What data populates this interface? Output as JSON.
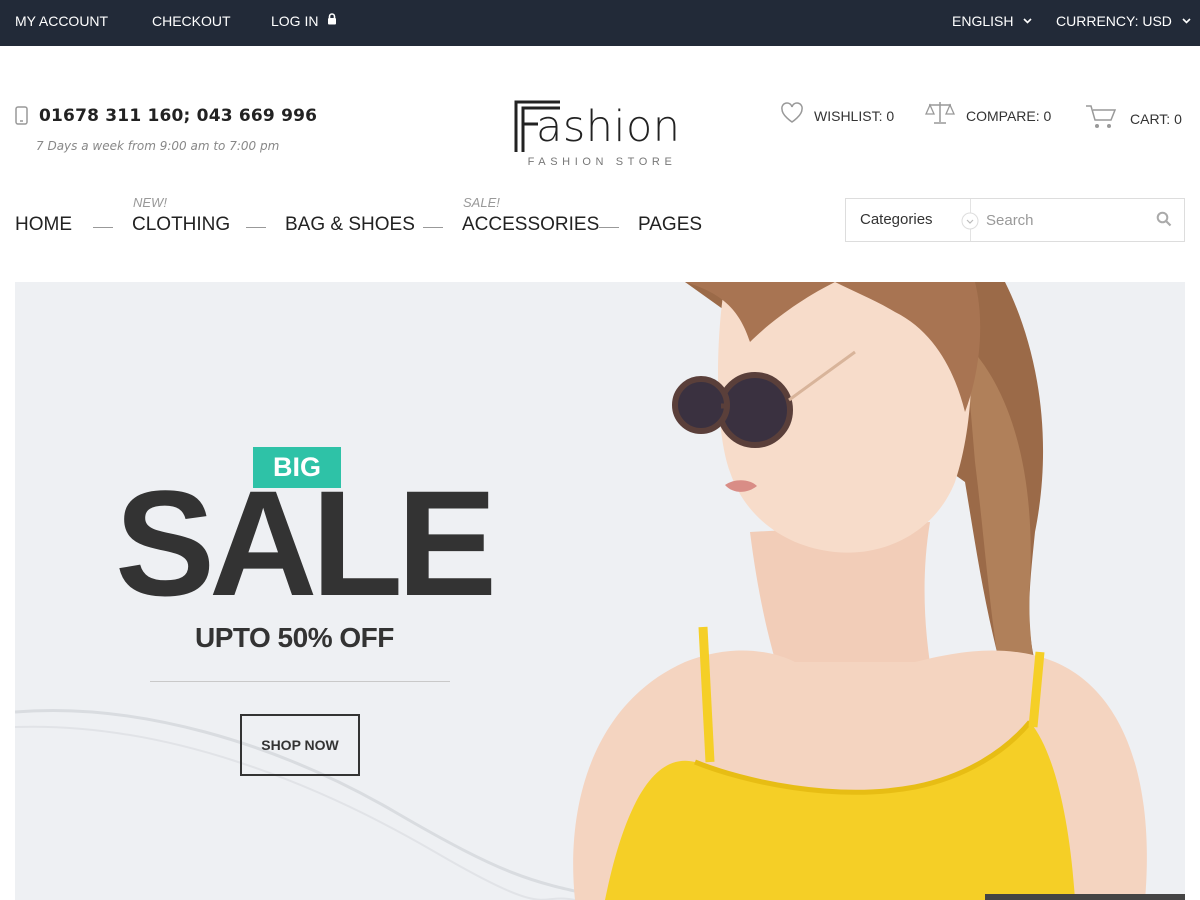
{
  "topbar": {
    "my_account": "MY ACCOUNT",
    "checkout": "CHECKOUT",
    "login": "LOG IN",
    "language": "ENGLISH",
    "currency": "CURRENCY: USD"
  },
  "header": {
    "phone": "01678 311 160; 043 669 996",
    "hours": "7 Days a week from 9:00 am to 7:00 pm",
    "logo_text": "ashion",
    "logo_subtitle": "FASHION STORE",
    "wishlist": "WISHLIST: 0",
    "compare": "COMPARE: 0",
    "cart": "CART: 0"
  },
  "nav": {
    "items": [
      {
        "label": "HOME",
        "tag": ""
      },
      {
        "label": "CLOTHING",
        "tag": "NEW!"
      },
      {
        "label": "BAG & SHOES",
        "tag": ""
      },
      {
        "label": "ACCESSORIES",
        "tag": "SALE!"
      },
      {
        "label": "PAGES",
        "tag": ""
      }
    ]
  },
  "search": {
    "category_label": "Categories",
    "placeholder": "Search"
  },
  "hero": {
    "badge": "BIG",
    "headline": "SALE",
    "subheadline": "UPTO 50% OFF",
    "button": "SHOP NOW"
  },
  "colors": {
    "topbar_bg": "#222a38",
    "badge": "#2ec2a7",
    "hero_bg": "#eef0f3",
    "dress": "#f5cf26"
  },
  "icons": [
    "lock-icon",
    "chevron-down-icon",
    "phone-icon",
    "heart-icon",
    "scale-icon",
    "cart-icon",
    "search-icon"
  ]
}
